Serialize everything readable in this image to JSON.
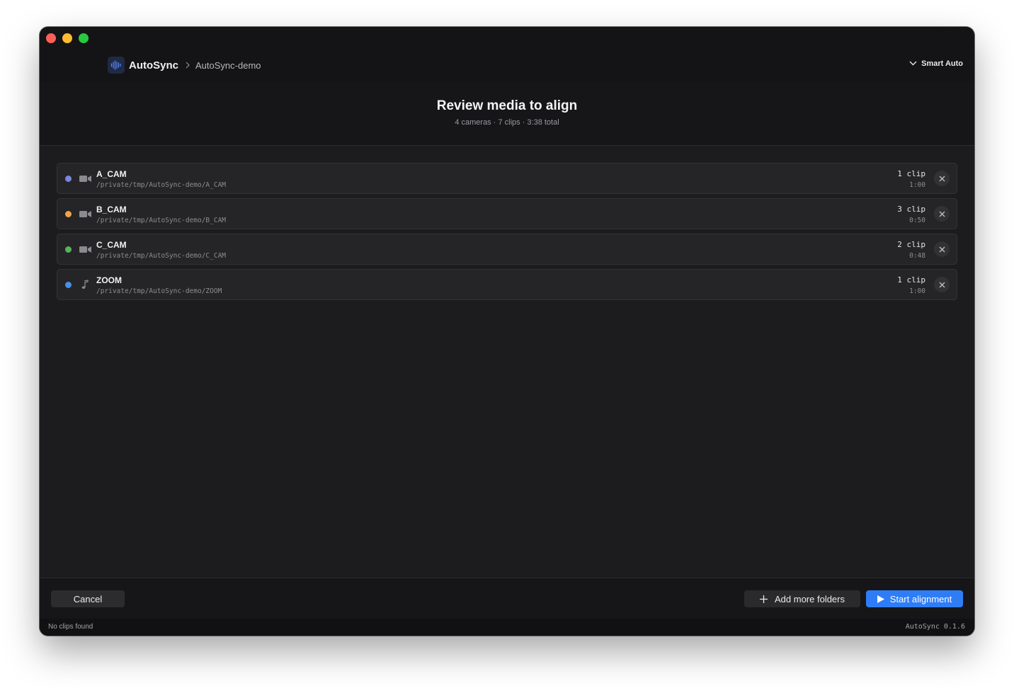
{
  "app": {
    "name": "AutoSync",
    "breadcrumb": "AutoSync-demo",
    "mode_label": "Smart Auto"
  },
  "hero": {
    "title": "Review media to align",
    "subtitle": "4 cameras · 7 clips · 3:38 total"
  },
  "sources": [
    {
      "name": "A_CAM",
      "path": "/private/tmp/AutoSync-demo/A_CAM",
      "count": "1 clip",
      "duration": "1:00",
      "kind": "camera",
      "color": "#7b86e0"
    },
    {
      "name": "B_CAM",
      "path": "/private/tmp/AutoSync-demo/B_CAM",
      "count": "3 clip",
      "duration": "0:50",
      "kind": "camera",
      "color": "#f0a44a"
    },
    {
      "name": "C_CAM",
      "path": "/private/tmp/AutoSync-demo/C_CAM",
      "count": "2 clip",
      "duration": "0:48",
      "kind": "camera",
      "color": "#56b45a"
    },
    {
      "name": "ZOOM",
      "path": "/private/tmp/AutoSync-demo/ZOOM",
      "count": "1 clip",
      "duration": "1:00",
      "kind": "audio",
      "color": "#4a8fe8"
    }
  ],
  "footer": {
    "cancel_label": "Cancel",
    "add_label": "Add more folders",
    "start_label": "Start alignment"
  },
  "status": {
    "message": "No clips found",
    "version": "AutoSync 0.1.6"
  },
  "colors": {
    "accent": "#2f7df6",
    "window_bg": "#1c1c1e"
  }
}
